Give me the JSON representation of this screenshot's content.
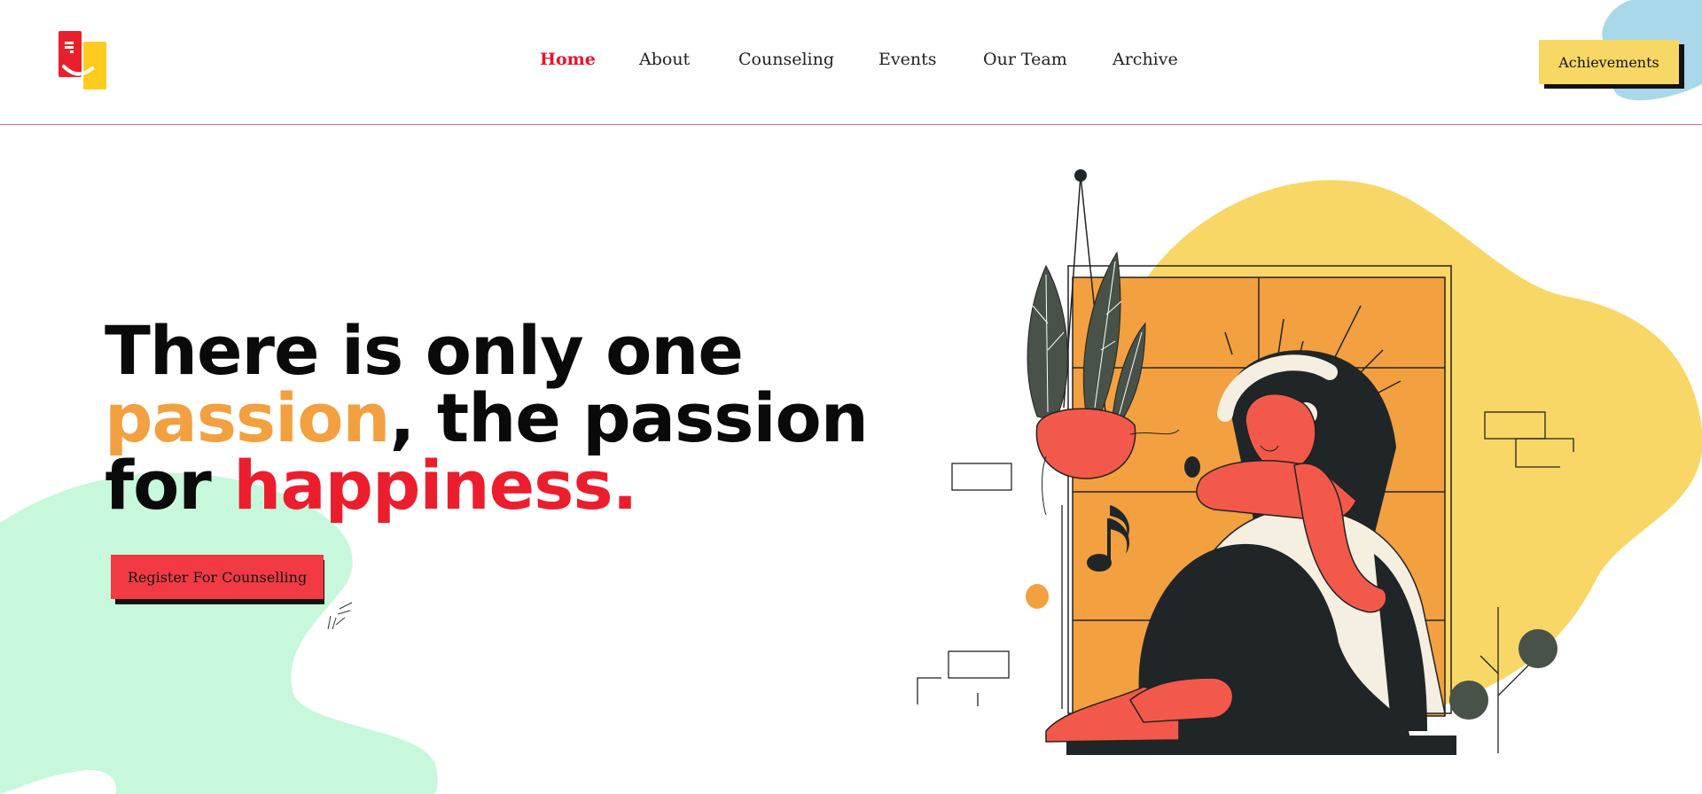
{
  "nav": {
    "items": [
      {
        "label": "Home",
        "active": true
      },
      {
        "label": "About",
        "active": false
      },
      {
        "label": "Counseling",
        "active": false
      },
      {
        "label": "Events",
        "active": false
      },
      {
        "label": "Our Team",
        "active": false
      },
      {
        "label": "Archive",
        "active": false
      }
    ]
  },
  "header": {
    "achievements_label": "Achievements"
  },
  "hero": {
    "line1": "There is only one",
    "line2_highlight": "passion",
    "line2_rest": ", the passion",
    "line3_prefix": "for ",
    "line3_highlight": "happiness.",
    "cta_label": "Register For Counselling"
  },
  "colors": {
    "accent_red": "#ec1e2d",
    "accent_orange": "#f2a040",
    "button_yellow": "#f7d864",
    "button_red": "#f23a45",
    "mint": "#c7f8dc",
    "blob_yellow": "#f8d766",
    "blob_blue": "#a9d8ea"
  }
}
